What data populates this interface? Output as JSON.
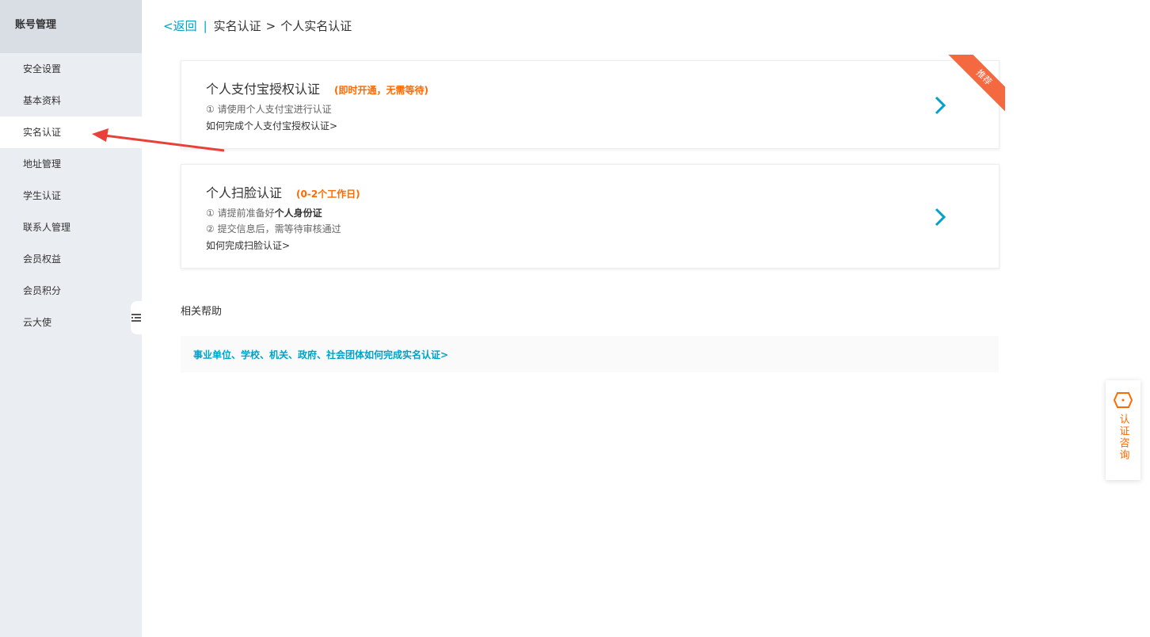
{
  "sidebar": {
    "header": "账号管理",
    "items": [
      {
        "label": "安全设置"
      },
      {
        "label": "基本资料"
      },
      {
        "label": "实名认证",
        "active": true
      },
      {
        "label": "地址管理"
      },
      {
        "label": "学生认证"
      },
      {
        "label": "联系人管理"
      },
      {
        "label": "会员权益"
      },
      {
        "label": "会员积分"
      },
      {
        "label": "云大使"
      }
    ]
  },
  "breadcrumb": {
    "back": "<返回",
    "separator": "|",
    "level1": "实名认证",
    "arrow": ">",
    "level2": "个人实名认证"
  },
  "cards": [
    {
      "title": "个人支付宝授权认证",
      "tag": "(即时开通，无需等待)",
      "line1": "① 请使用个人支付宝进行认证",
      "link": "如何完成个人支付宝授权认证>",
      "ribbon": "推荐"
    },
    {
      "title": "个人扫脸认证",
      "tag": "(0-2个工作日)",
      "line1_prefix": "① 请提前准备好",
      "line1_bold": "个人身份证",
      "line2": "② 提交信息后，需等待审核通过",
      "link": "如何完成扫脸认证>"
    }
  ],
  "help": {
    "title": "相关帮助",
    "link": "事业单位、学校、机关、政府、社会团体如何完成实名认证>"
  },
  "consult": {
    "label": "认证咨询"
  },
  "colors": {
    "accent": "#00a2ca",
    "orange": "#ff6a00",
    "ribbon": "#f4693f",
    "annotation": "#e8413a"
  }
}
